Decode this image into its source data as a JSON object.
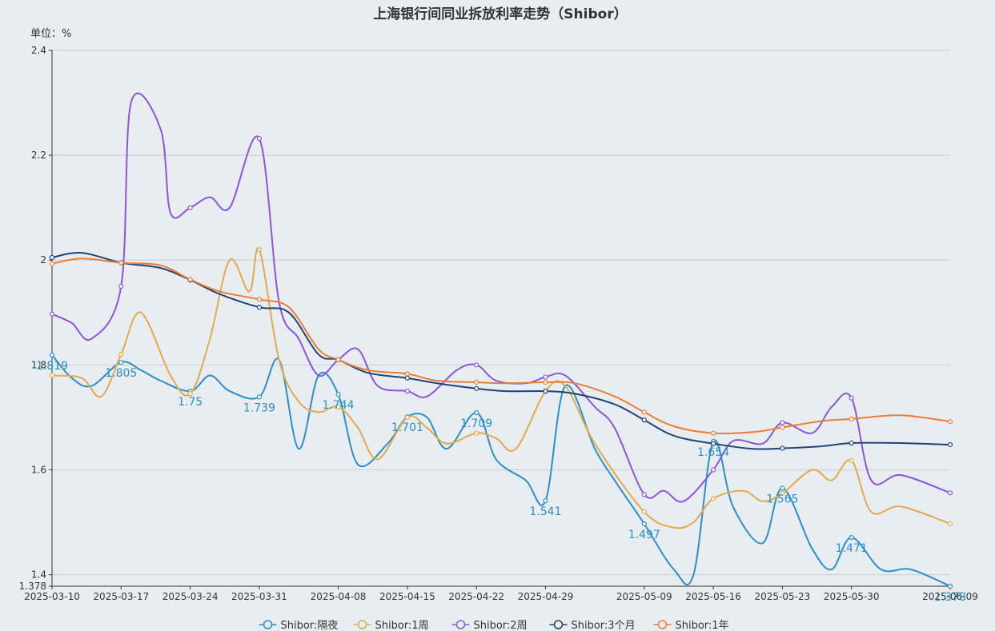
{
  "chart_data": {
    "type": "line",
    "title": "上海银行间同业拆放利率走势（Shibor）",
    "unit_label": "单位：%",
    "y_axis": {
      "min": 1.378,
      "max": 2.4,
      "ticks": [
        "1.378",
        "1.4",
        "1.6",
        "1.8",
        "2",
        "2.2",
        "2.4"
      ]
    },
    "x_axis": {
      "min": "2025-03-10",
      "max": "2025-06-09",
      "ticks": [
        "2025-03-10",
        "2025-03-17",
        "2025-03-24",
        "2025-03-31",
        "2025-04-08",
        "2025-04-15",
        "2025-04-22",
        "2025-04-29",
        "2025-05-09",
        "2025-05-16",
        "2025-05-23",
        "2025-05-30",
        "2025-06-09"
      ]
    },
    "grid": true,
    "legend_position": "bottom",
    "series": [
      {
        "name": "Shibor:隔夜",
        "color": "#2b8fcb",
        "labeled": true,
        "points": [
          [
            "2025-03-10",
            1.819
          ],
          [
            "2025-03-12",
            1.775
          ],
          [
            "2025-03-14",
            1.76
          ],
          [
            "2025-03-17",
            1.805
          ],
          [
            "2025-03-19",
            1.79
          ],
          [
            "2025-03-21",
            1.77
          ],
          [
            "2025-03-24",
            1.75
          ],
          [
            "2025-03-26",
            1.78
          ],
          [
            "2025-03-28",
            1.75
          ],
          [
            "2025-03-31",
            1.739
          ],
          [
            "2025-04-02",
            1.81
          ],
          [
            "2025-04-04",
            1.64
          ],
          [
            "2025-04-06",
            1.78
          ],
          [
            "2025-04-08",
            1.744
          ],
          [
            "2025-04-10",
            1.61
          ],
          [
            "2025-04-13",
            1.65
          ],
          [
            "2025-04-15",
            1.701
          ],
          [
            "2025-04-17",
            1.7
          ],
          [
            "2025-04-19",
            1.64
          ],
          [
            "2025-04-22",
            1.709
          ],
          [
            "2025-04-24",
            1.62
          ],
          [
            "2025-04-27",
            1.58
          ],
          [
            "2025-04-29",
            1.541
          ],
          [
            "2025-05-01",
            1.76
          ],
          [
            "2025-05-04",
            1.64
          ],
          [
            "2025-05-06",
            1.58
          ],
          [
            "2025-05-09",
            1.497
          ],
          [
            "2025-05-12",
            1.41
          ],
          [
            "2025-05-14",
            1.4
          ],
          [
            "2025-05-16",
            1.654
          ],
          [
            "2025-05-18",
            1.53
          ],
          [
            "2025-05-21",
            1.46
          ],
          [
            "2025-05-23",
            1.565
          ],
          [
            "2025-05-26",
            1.45
          ],
          [
            "2025-05-28",
            1.41
          ],
          [
            "2025-05-30",
            1.471
          ],
          [
            "2025-06-02",
            1.41
          ],
          [
            "2025-06-05",
            1.41
          ],
          [
            "2025-06-09",
            1.378
          ]
        ],
        "labels": [
          [
            "2025-03-10",
            1.819
          ],
          [
            "2025-03-17",
            1.805
          ],
          [
            "2025-03-24",
            1.75
          ],
          [
            "2025-03-31",
            1.739
          ],
          [
            "2025-04-08",
            1.744
          ],
          [
            "2025-04-15",
            1.701
          ],
          [
            "2025-04-22",
            1.709
          ],
          [
            "2025-04-29",
            1.541
          ],
          [
            "2025-05-09",
            1.497
          ],
          [
            "2025-05-16",
            1.654
          ],
          [
            "2025-05-23",
            1.565
          ],
          [
            "2025-05-30",
            1.471
          ],
          [
            "2025-06-09",
            1.378
          ]
        ]
      },
      {
        "name": "Shibor:1周",
        "color": "#e3a94a",
        "points": [
          [
            "2025-03-10",
            1.78
          ],
          [
            "2025-03-13",
            1.775
          ],
          [
            "2025-03-15",
            1.74
          ],
          [
            "2025-03-17",
            1.82
          ],
          [
            "2025-03-19",
            1.9
          ],
          [
            "2025-03-22",
            1.78
          ],
          [
            "2025-03-24",
            1.745
          ],
          [
            "2025-03-26",
            1.85
          ],
          [
            "2025-03-28",
            2.0
          ],
          [
            "2025-03-30",
            1.94
          ],
          [
            "2025-03-31",
            2.02
          ],
          [
            "2025-04-02",
            1.81
          ],
          [
            "2025-04-04",
            1.73
          ],
          [
            "2025-04-06",
            1.71
          ],
          [
            "2025-04-08",
            1.72
          ],
          [
            "2025-04-10",
            1.68
          ],
          [
            "2025-04-12",
            1.62
          ],
          [
            "2025-04-15",
            1.7
          ],
          [
            "2025-04-17",
            1.68
          ],
          [
            "2025-04-19",
            1.65
          ],
          [
            "2025-04-22",
            1.67
          ],
          [
            "2025-04-24",
            1.66
          ],
          [
            "2025-04-26",
            1.64
          ],
          [
            "2025-04-29",
            1.75
          ],
          [
            "2025-05-01",
            1.76
          ],
          [
            "2025-05-04",
            1.65
          ],
          [
            "2025-05-09",
            1.52
          ],
          [
            "2025-05-12",
            1.49
          ],
          [
            "2025-05-14",
            1.5
          ],
          [
            "2025-05-16",
            1.545
          ],
          [
            "2025-05-19",
            1.56
          ],
          [
            "2025-05-21",
            1.54
          ],
          [
            "2025-05-23",
            1.555
          ],
          [
            "2025-05-26",
            1.6
          ],
          [
            "2025-05-28",
            1.58
          ],
          [
            "2025-05-30",
            1.618
          ],
          [
            "2025-06-01",
            1.52
          ],
          [
            "2025-06-04",
            1.53
          ],
          [
            "2025-06-09",
            1.497
          ]
        ]
      },
      {
        "name": "Shibor:2周",
        "color": "#8b55dd",
        "points": [
          [
            "2025-03-10",
            1.897
          ],
          [
            "2025-03-12",
            1.88
          ],
          [
            "2025-03-14",
            1.85
          ],
          [
            "2025-03-17",
            1.95
          ],
          [
            "2025-03-18",
            2.3
          ],
          [
            "2025-03-21",
            2.25
          ],
          [
            "2025-03-22",
            2.09
          ],
          [
            "2025-03-24",
            2.1
          ],
          [
            "2025-03-26",
            2.12
          ],
          [
            "2025-03-28",
            2.1
          ],
          [
            "2025-03-31",
            2.232
          ],
          [
            "2025-04-02",
            1.92
          ],
          [
            "2025-04-04",
            1.85
          ],
          [
            "2025-04-06",
            1.78
          ],
          [
            "2025-04-08",
            1.81
          ],
          [
            "2025-04-10",
            1.83
          ],
          [
            "2025-04-12",
            1.76
          ],
          [
            "2025-04-15",
            1.75
          ],
          [
            "2025-04-17",
            1.74
          ],
          [
            "2025-04-20",
            1.79
          ],
          [
            "2025-04-22",
            1.8
          ],
          [
            "2025-04-24",
            1.77
          ],
          [
            "2025-04-27",
            1.765
          ],
          [
            "2025-04-29",
            1.777
          ],
          [
            "2025-05-01",
            1.78
          ],
          [
            "2025-05-04",
            1.72
          ],
          [
            "2025-05-06",
            1.68
          ],
          [
            "2025-05-09",
            1.553
          ],
          [
            "2025-05-11",
            1.56
          ],
          [
            "2025-05-13",
            1.54
          ],
          [
            "2025-05-16",
            1.6
          ],
          [
            "2025-05-18",
            1.655
          ],
          [
            "2025-05-21",
            1.65
          ],
          [
            "2025-05-23",
            1.69
          ],
          [
            "2025-05-26",
            1.67
          ],
          [
            "2025-05-28",
            1.72
          ],
          [
            "2025-05-30",
            1.737
          ],
          [
            "2025-06-01",
            1.58
          ],
          [
            "2025-06-04",
            1.59
          ],
          [
            "2025-06-09",
            1.556
          ]
        ]
      },
      {
        "name": "Shibor:3个月",
        "color": "#1f4478",
        "points": [
          [
            "2025-03-10",
            2.005
          ],
          [
            "2025-03-13",
            2.014
          ],
          [
            "2025-03-17",
            1.995
          ],
          [
            "2025-03-21",
            1.985
          ],
          [
            "2025-03-24",
            1.962
          ],
          [
            "2025-03-27",
            1.935
          ],
          [
            "2025-03-31",
            1.91
          ],
          [
            "2025-04-03",
            1.9
          ],
          [
            "2025-04-06",
            1.82
          ],
          [
            "2025-04-08",
            1.81
          ],
          [
            "2025-04-11",
            1.785
          ],
          [
            "2025-04-15",
            1.775
          ],
          [
            "2025-04-18",
            1.765
          ],
          [
            "2025-04-22",
            1.755
          ],
          [
            "2025-04-25",
            1.75
          ],
          [
            "2025-04-29",
            1.75
          ],
          [
            "2025-05-02",
            1.745
          ],
          [
            "2025-05-06",
            1.725
          ],
          [
            "2025-05-09",
            1.695
          ],
          [
            "2025-05-12",
            1.665
          ],
          [
            "2025-05-16",
            1.65
          ],
          [
            "2025-05-20",
            1.64
          ],
          [
            "2025-05-23",
            1.641
          ],
          [
            "2025-05-27",
            1.645
          ],
          [
            "2025-05-30",
            1.651
          ],
          [
            "2025-06-04",
            1.651
          ],
          [
            "2025-06-09",
            1.648
          ]
        ]
      },
      {
        "name": "Shibor:1年",
        "color": "#ed7d31",
        "points": [
          [
            "2025-03-10",
            1.993
          ],
          [
            "2025-03-13",
            2.003
          ],
          [
            "2025-03-17",
            1.995
          ],
          [
            "2025-03-21",
            1.99
          ],
          [
            "2025-03-24",
            1.963
          ],
          [
            "2025-03-27",
            1.94
          ],
          [
            "2025-03-31",
            1.925
          ],
          [
            "2025-04-03",
            1.91
          ],
          [
            "2025-04-06",
            1.83
          ],
          [
            "2025-04-08",
            1.81
          ],
          [
            "2025-04-11",
            1.79
          ],
          [
            "2025-04-15",
            1.783
          ],
          [
            "2025-04-18",
            1.77
          ],
          [
            "2025-04-22",
            1.767
          ],
          [
            "2025-04-25",
            1.765
          ],
          [
            "2025-04-29",
            1.767
          ],
          [
            "2025-05-02",
            1.765
          ],
          [
            "2025-05-06",
            1.74
          ],
          [
            "2025-05-09",
            1.71
          ],
          [
            "2025-05-12",
            1.683
          ],
          [
            "2025-05-16",
            1.67
          ],
          [
            "2025-05-20",
            1.672
          ],
          [
            "2025-05-23",
            1.681
          ],
          [
            "2025-05-27",
            1.693
          ],
          [
            "2025-05-30",
            1.697
          ],
          [
            "2025-06-04",
            1.704
          ],
          [
            "2025-06-09",
            1.692
          ]
        ]
      }
    ]
  }
}
